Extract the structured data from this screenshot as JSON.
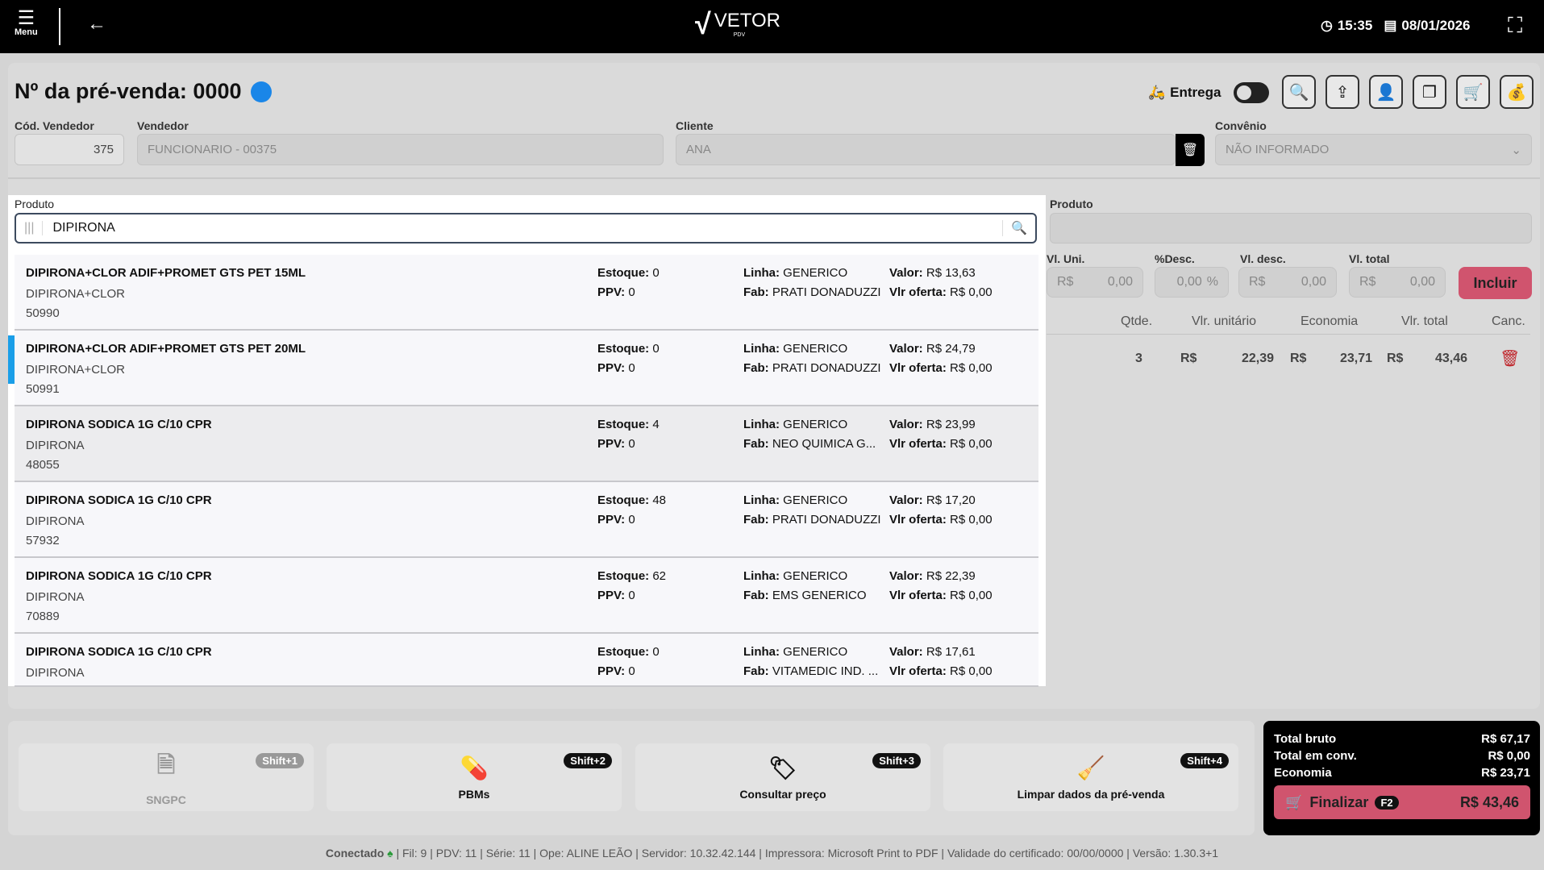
{
  "topbar": {
    "menu_label": "Menu",
    "logo_text": "VETOR",
    "logo_sub": "PDV",
    "time": "15:35",
    "date": "08/01/2026"
  },
  "header": {
    "title": "Nº da pré-venda: 0000",
    "delivery_label": "Entrega",
    "status_color": "#1a86e8"
  },
  "fields": {
    "cod_vendedor_label": "Cód. Vendedor",
    "cod_vendedor": "375",
    "vendedor_label": "Vendedor",
    "vendedor": "FUNCIONARIO - 00375",
    "cliente_label": "Cliente",
    "cliente": "ANA",
    "convenio_label": "Convênio",
    "convenio": "NÃO INFORMADO"
  },
  "search": {
    "label": "Produto",
    "value": "DIPIRONA"
  },
  "results": [
    {
      "name": "DIPIRONA+CLOR ADIF+PROMET GTS PET 15ML",
      "sub": "DIPIRONA+CLOR",
      "code": "50990",
      "estoque": "0",
      "ppv": "0",
      "linha": "GENERICO",
      "fab": "PRATI DONADUZZI",
      "valor": "R$ 13,63",
      "oferta": "R$ 0,00"
    },
    {
      "name": "DIPIRONA+CLOR ADIF+PROMET GTS PET 20ML",
      "sub": "DIPIRONA+CLOR",
      "code": "50991",
      "estoque": "0",
      "ppv": "0",
      "linha": "GENERICO",
      "fab": "PRATI DONADUZZI",
      "valor": "R$ 24,79",
      "oferta": "R$ 0,00"
    },
    {
      "name": "DIPIRONA SODICA 1G C/10 CPR",
      "sub": "DIPIRONA",
      "code": "48055",
      "estoque": "4",
      "ppv": "0",
      "linha": "GENERICO",
      "fab": "NEO QUIMICA G...",
      "valor": "R$ 23,99",
      "oferta": "R$ 0,00"
    },
    {
      "name": "DIPIRONA SODICA 1G C/10 CPR",
      "sub": "DIPIRONA",
      "code": "57932",
      "estoque": "48",
      "ppv": "0",
      "linha": "GENERICO",
      "fab": "PRATI DONADUZZI",
      "valor": "R$ 17,20",
      "oferta": "R$ 0,00"
    },
    {
      "name": "DIPIRONA SODICA 1G C/10 CPR",
      "sub": "DIPIRONA",
      "code": "70889",
      "estoque": "62",
      "ppv": "0",
      "linha": "GENERICO",
      "fab": "EMS GENERICO",
      "valor": "R$ 22,39",
      "oferta": "R$ 0,00"
    },
    {
      "name": "DIPIRONA SODICA 1G C/10 CPR",
      "sub": "DIPIRONA",
      "code": "",
      "estoque": "0",
      "ppv": "0",
      "linha": "GENERICO",
      "fab": "VITAMEDIC IND. ...",
      "valor": "R$ 17,61",
      "oferta": "R$ 0,00"
    }
  ],
  "result_labels": {
    "estoque": "Estoque:",
    "ppv": "PPV:",
    "linha": "Linha:",
    "fab": "Fab:",
    "valor": "Valor:",
    "oferta": "Vlr oferta:"
  },
  "right": {
    "produto_label": "Produto",
    "vl_uni_label": "Vl. Uni.",
    "desc_label": "%Desc.",
    "vl_desc_label": "Vl. desc.",
    "vl_total_label": "Vl. total",
    "currency": "R$",
    "vl_uni": "0,00",
    "desc": "0,00",
    "pct": "%",
    "vl_desc": "0,00",
    "vl_total": "0,00",
    "incluir": "Incluir"
  },
  "table": {
    "headers": [
      "Qtde.",
      "Vlr. unitário",
      "Economia",
      "Vlr. total",
      "Canc."
    ],
    "row": {
      "qtde": "3",
      "unit": "22,39",
      "economia": "23,71",
      "total": "43,46"
    }
  },
  "actions": [
    {
      "label": "SNGPC",
      "key": "Shift+1"
    },
    {
      "label": "PBMs",
      "key": "Shift+2"
    },
    {
      "label": "Consultar preço",
      "key": "Shift+3"
    },
    {
      "label": "Limpar dados da pré-venda",
      "key": "Shift+4"
    }
  ],
  "totals": {
    "bruto_label": "Total bruto",
    "bruto": "R$ 67,17",
    "conv_label": "Total em conv.",
    "conv": "R$ 0,00",
    "eco_label": "Economia",
    "eco": "R$ 23,71",
    "finalizar": "Finalizar",
    "key": "F2",
    "final": "R$ 43,46"
  },
  "status": {
    "conectado": "Conectado",
    "info": "| Fil: 9 | PDV: 11 | Série: 11 | Ope: ALINE LEÃO | Servidor: 10.32.42.144 | Impressora: Microsoft Print to PDF | Validade do certificado: 00/00/0000 | Versão: 1.30.3+1"
  }
}
